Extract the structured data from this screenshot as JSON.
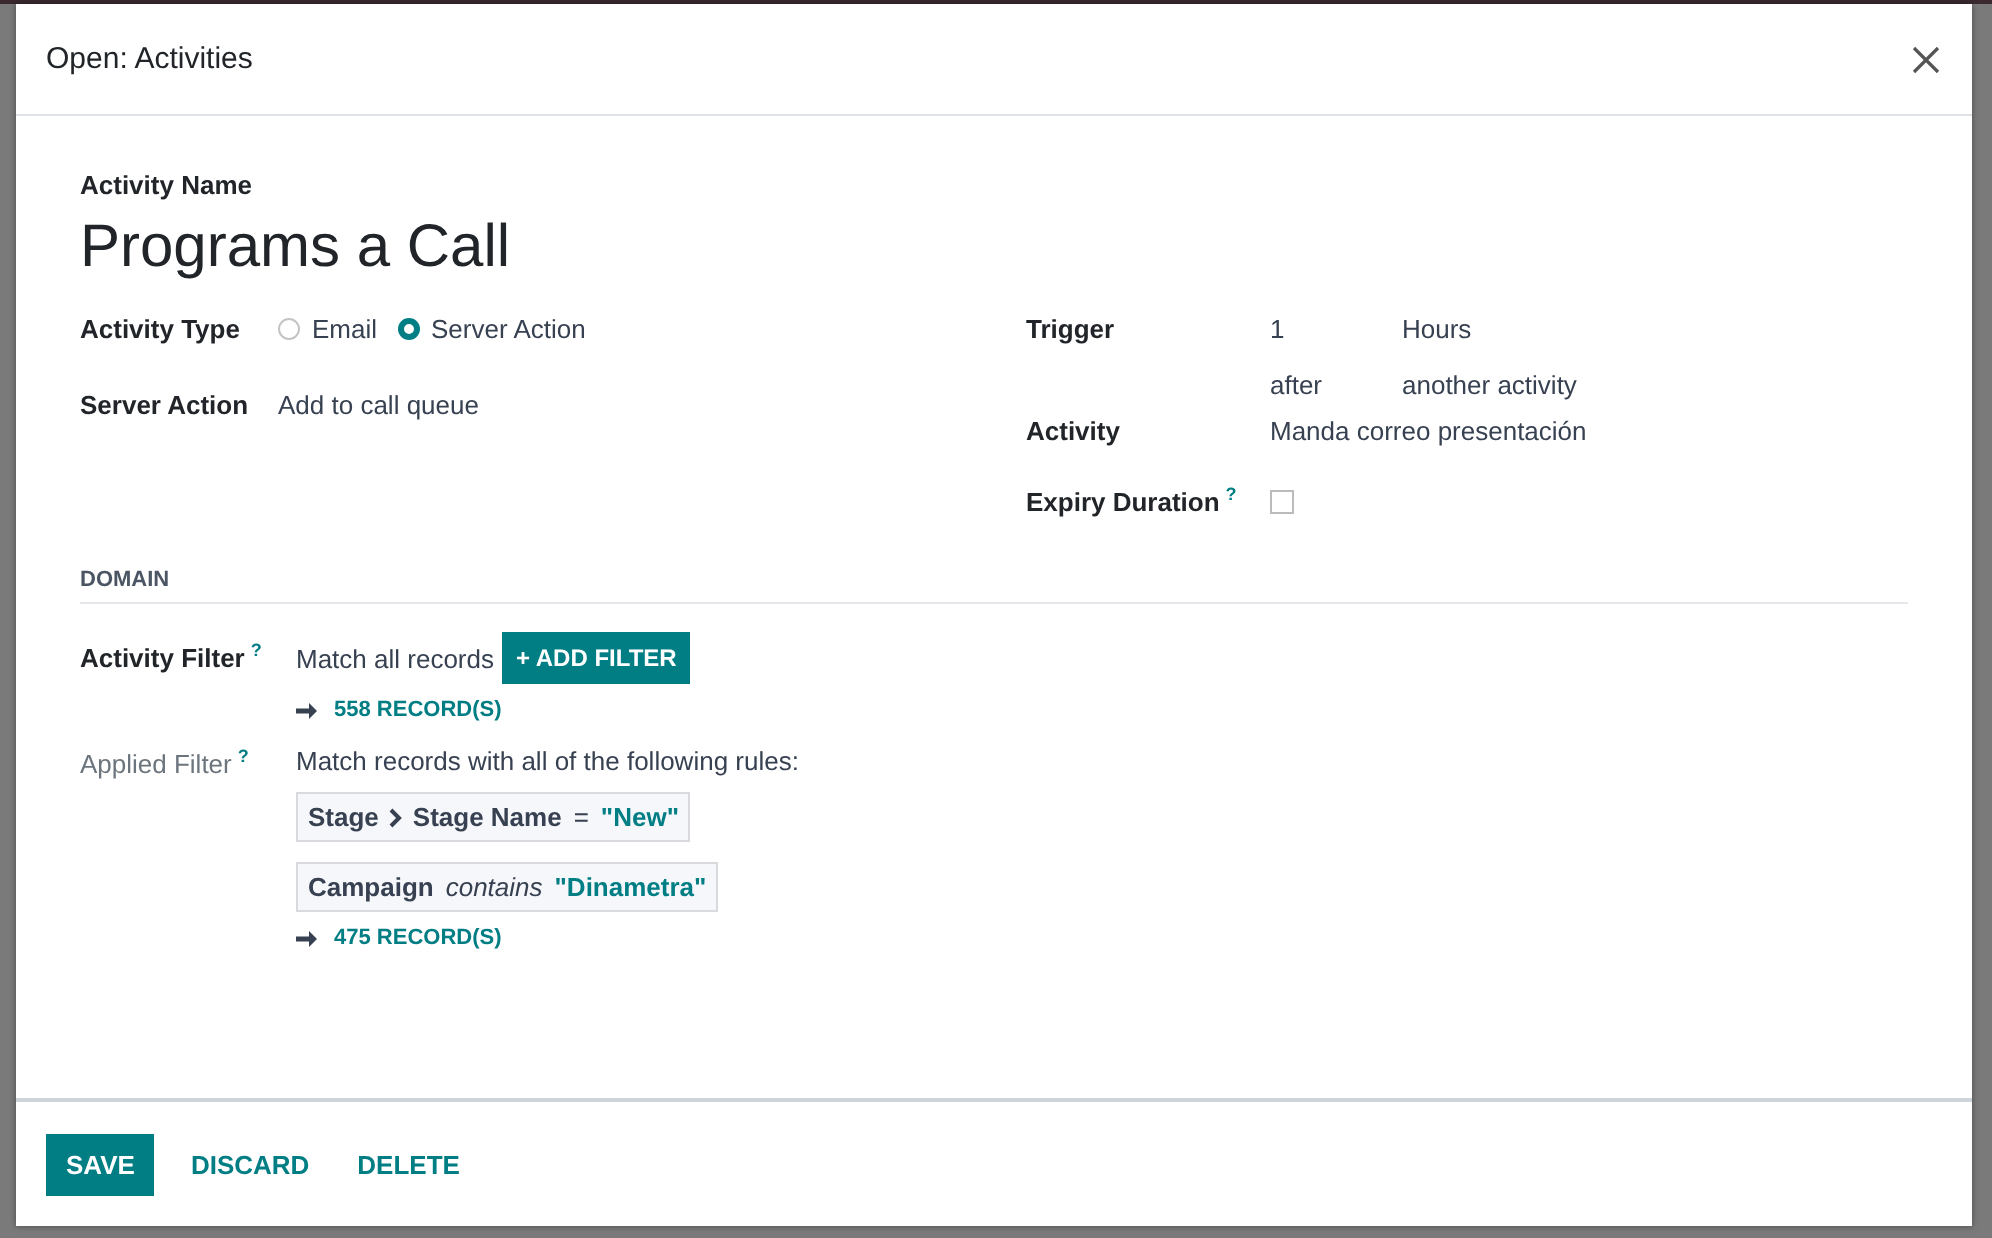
{
  "dialog": {
    "title": "Open: Activities"
  },
  "name": {
    "label": "Activity Name",
    "value": "Programs a Call"
  },
  "left_fields": [
    {
      "kind": "radio",
      "label": "Activity Type",
      "options": [
        {
          "label": "Email",
          "selected": false
        },
        {
          "label": "Server Action",
          "selected": true
        }
      ]
    },
    {
      "kind": "text",
      "label": "Server Action",
      "value": "Add to call queue"
    }
  ],
  "right_fields": [
    {
      "kind": "trigger",
      "label": "Trigger",
      "interval": "1",
      "unit": "Hours",
      "when": "after",
      "reference": "another activity"
    },
    {
      "kind": "text",
      "label": "Activity",
      "value": "Manda correo presentación"
    },
    {
      "kind": "checkbox",
      "label": "Expiry Duration",
      "help": "?",
      "checked": false
    }
  ],
  "domain": {
    "title": "DOMAIN",
    "activity_filter": {
      "label": "Activity Filter",
      "help": "?",
      "summary": "Match all records",
      "button": "+ ADD FILTER",
      "records": "558 RECORD(S)"
    },
    "applied_filter": {
      "label": "Applied Filter",
      "help": "?",
      "summary": "Match records with all of the following rules:",
      "rules": [
        {
          "path": [
            "Stage",
            "Stage Name"
          ],
          "operator": "=",
          "value": "\"New\""
        },
        {
          "path": [
            "Campaign"
          ],
          "operator": "*contains*",
          "value": "\"Dinametra\""
        }
      ],
      "records": "475 RECORD(S)"
    }
  },
  "footer": [
    {
      "kind": "primary",
      "label": "SAVE"
    },
    {
      "kind": "link",
      "label": "DISCARD"
    },
    {
      "kind": "link",
      "label": "DELETE"
    }
  ]
}
